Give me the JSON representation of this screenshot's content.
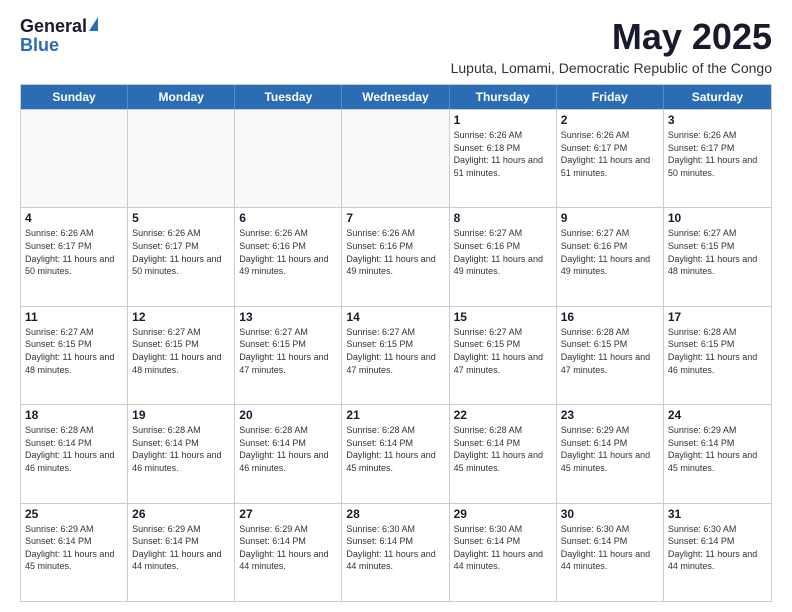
{
  "header": {
    "logo_general": "General",
    "logo_blue": "Blue",
    "month_title": "May 2025",
    "location": "Luputa, Lomami, Democratic Republic of the Congo"
  },
  "days_of_week": [
    "Sunday",
    "Monday",
    "Tuesday",
    "Wednesday",
    "Thursday",
    "Friday",
    "Saturday"
  ],
  "weeks": [
    [
      {
        "day": "",
        "info": ""
      },
      {
        "day": "",
        "info": ""
      },
      {
        "day": "",
        "info": ""
      },
      {
        "day": "",
        "info": ""
      },
      {
        "day": "1",
        "info": "Sunrise: 6:26 AM\nSunset: 6:18 PM\nDaylight: 11 hours and 51 minutes."
      },
      {
        "day": "2",
        "info": "Sunrise: 6:26 AM\nSunset: 6:17 PM\nDaylight: 11 hours and 51 minutes."
      },
      {
        "day": "3",
        "info": "Sunrise: 6:26 AM\nSunset: 6:17 PM\nDaylight: 11 hours and 50 minutes."
      }
    ],
    [
      {
        "day": "4",
        "info": "Sunrise: 6:26 AM\nSunset: 6:17 PM\nDaylight: 11 hours and 50 minutes."
      },
      {
        "day": "5",
        "info": "Sunrise: 6:26 AM\nSunset: 6:17 PM\nDaylight: 11 hours and 50 minutes."
      },
      {
        "day": "6",
        "info": "Sunrise: 6:26 AM\nSunset: 6:16 PM\nDaylight: 11 hours and 49 minutes."
      },
      {
        "day": "7",
        "info": "Sunrise: 6:26 AM\nSunset: 6:16 PM\nDaylight: 11 hours and 49 minutes."
      },
      {
        "day": "8",
        "info": "Sunrise: 6:27 AM\nSunset: 6:16 PM\nDaylight: 11 hours and 49 minutes."
      },
      {
        "day": "9",
        "info": "Sunrise: 6:27 AM\nSunset: 6:16 PM\nDaylight: 11 hours and 49 minutes."
      },
      {
        "day": "10",
        "info": "Sunrise: 6:27 AM\nSunset: 6:15 PM\nDaylight: 11 hours and 48 minutes."
      }
    ],
    [
      {
        "day": "11",
        "info": "Sunrise: 6:27 AM\nSunset: 6:15 PM\nDaylight: 11 hours and 48 minutes."
      },
      {
        "day": "12",
        "info": "Sunrise: 6:27 AM\nSunset: 6:15 PM\nDaylight: 11 hours and 48 minutes."
      },
      {
        "day": "13",
        "info": "Sunrise: 6:27 AM\nSunset: 6:15 PM\nDaylight: 11 hours and 47 minutes."
      },
      {
        "day": "14",
        "info": "Sunrise: 6:27 AM\nSunset: 6:15 PM\nDaylight: 11 hours and 47 minutes."
      },
      {
        "day": "15",
        "info": "Sunrise: 6:27 AM\nSunset: 6:15 PM\nDaylight: 11 hours and 47 minutes."
      },
      {
        "day": "16",
        "info": "Sunrise: 6:28 AM\nSunset: 6:15 PM\nDaylight: 11 hours and 47 minutes."
      },
      {
        "day": "17",
        "info": "Sunrise: 6:28 AM\nSunset: 6:15 PM\nDaylight: 11 hours and 46 minutes."
      }
    ],
    [
      {
        "day": "18",
        "info": "Sunrise: 6:28 AM\nSunset: 6:14 PM\nDaylight: 11 hours and 46 minutes."
      },
      {
        "day": "19",
        "info": "Sunrise: 6:28 AM\nSunset: 6:14 PM\nDaylight: 11 hours and 46 minutes."
      },
      {
        "day": "20",
        "info": "Sunrise: 6:28 AM\nSunset: 6:14 PM\nDaylight: 11 hours and 46 minutes."
      },
      {
        "day": "21",
        "info": "Sunrise: 6:28 AM\nSunset: 6:14 PM\nDaylight: 11 hours and 45 minutes."
      },
      {
        "day": "22",
        "info": "Sunrise: 6:28 AM\nSunset: 6:14 PM\nDaylight: 11 hours and 45 minutes."
      },
      {
        "day": "23",
        "info": "Sunrise: 6:29 AM\nSunset: 6:14 PM\nDaylight: 11 hours and 45 minutes."
      },
      {
        "day": "24",
        "info": "Sunrise: 6:29 AM\nSunset: 6:14 PM\nDaylight: 11 hours and 45 minutes."
      }
    ],
    [
      {
        "day": "25",
        "info": "Sunrise: 6:29 AM\nSunset: 6:14 PM\nDaylight: 11 hours and 45 minutes."
      },
      {
        "day": "26",
        "info": "Sunrise: 6:29 AM\nSunset: 6:14 PM\nDaylight: 11 hours and 44 minutes."
      },
      {
        "day": "27",
        "info": "Sunrise: 6:29 AM\nSunset: 6:14 PM\nDaylight: 11 hours and 44 minutes."
      },
      {
        "day": "28",
        "info": "Sunrise: 6:30 AM\nSunset: 6:14 PM\nDaylight: 11 hours and 44 minutes."
      },
      {
        "day": "29",
        "info": "Sunrise: 6:30 AM\nSunset: 6:14 PM\nDaylight: 11 hours and 44 minutes."
      },
      {
        "day": "30",
        "info": "Sunrise: 6:30 AM\nSunset: 6:14 PM\nDaylight: 11 hours and 44 minutes."
      },
      {
        "day": "31",
        "info": "Sunrise: 6:30 AM\nSunset: 6:14 PM\nDaylight: 11 hours and 44 minutes."
      }
    ]
  ]
}
